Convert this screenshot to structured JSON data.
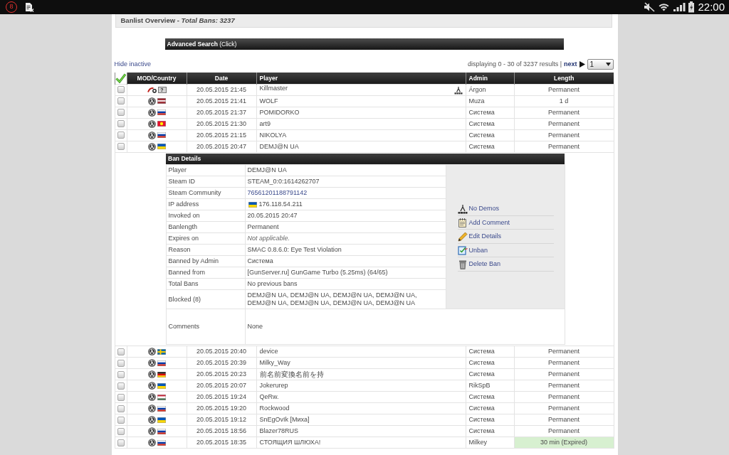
{
  "status_bar": {
    "notifications": "8",
    "time": "22:00"
  },
  "header": {
    "title": "Banlist Overview - *Total Bans: 3237*"
  },
  "advanced_search": {
    "label": "**Advanced Search** (Click)"
  },
  "toolbar": {
    "filter_link": "Hide inactive",
    "summary": "displaying 0 - 30 of 3237 results |",
    "next": "next",
    "page": "1"
  },
  "table": {
    "columns": [
      "MOD/Country",
      "Date",
      "Player",
      "Admin",
      "Length"
    ],
    "rows": [
      {
        "checked": false,
        "mod": {
          "kind": "other"
        },
        "flag": {
          "kind": "unknown",
          "label": "?"
        },
        "date": "20.05.2015 21:45",
        "player": "Killmaster",
        "demo": true,
        "admin": "Árgon",
        "length": "Permanent",
        "expired": false
      },
      {
        "checked": false,
        "mod": {
          "kind": "lambda"
        },
        "flag": {
          "kind": "lv"
        },
        "date": "20.05.2015 21:41",
        "player": "WOLF",
        "demo": false,
        "admin": "Muza",
        "length": "1 d",
        "expired": false
      },
      {
        "checked": false,
        "mod": {
          "kind": "lambda"
        },
        "flag": {
          "kind": "ru"
        },
        "date": "20.05.2015 21:37",
        "player": "POMIDORKO",
        "demo": false,
        "admin": "Система",
        "length": "Permanent",
        "expired": false
      },
      {
        "checked": false,
        "mod": {
          "kind": "lambda"
        },
        "flag": {
          "kind": "kg"
        },
        "date": "20.05.2015 21:30",
        "player": "art9",
        "demo": false,
        "admin": "Система",
        "length": "Permanent",
        "expired": false
      },
      {
        "checked": false,
        "mod": {
          "kind": "lambda"
        },
        "flag": {
          "kind": "ru"
        },
        "date": "20.05.2015 21:15",
        "player": "NIKOLYA",
        "demo": false,
        "admin": "Система",
        "length": "Permanent",
        "expired": false
      },
      {
        "checked": false,
        "mod": {
          "kind": "lambda"
        },
        "flag": {
          "kind": "ua"
        },
        "date": "20.05.2015 20:47",
        "player": "DEMJ@N UA",
        "demo": false,
        "admin": "Система",
        "length": "Permanent",
        "expired": false,
        "details": {
          "title": "Ban Details",
          "fields": [
            {
              "kind": "text",
              "label": "Player",
              "value": "DEMJ@N UA"
            },
            {
              "kind": "text",
              "label": "Steam ID",
              "value": "STEAM_0:0:1614262707"
            },
            {
              "kind": "link",
              "label": "Steam Community",
              "value": "76561201188791142"
            },
            {
              "kind": "ip",
              "label": "IP address",
              "value": "176.118.54.211",
              "flag": {
                "kind": "ua"
              }
            },
            {
              "kind": "text",
              "label": "Invoked on",
              "value": "20.05.2015 20:47"
            },
            {
              "kind": "text",
              "label": "Banlength",
              "value": "Permanent"
            },
            {
              "kind": "note",
              "label": "Expires on",
              "value": "Not applicable."
            },
            {
              "kind": "text",
              "label": "Reason",
              "value": "SMAC 0.8.6.0: Eye Test Violation"
            },
            {
              "kind": "text",
              "label": "Banned by Admin",
              "value": "Система"
            },
            {
              "kind": "text",
              "label": "Banned from",
              "value": "[GunServer.ru] GunGame Turbo (5.25ms) (64/65)"
            },
            {
              "kind": "text",
              "label": "Total Bans",
              "value": "No previous bans"
            },
            {
              "kind": "text",
              "label": "Blocked (8)",
              "value": "DEMJ@N UA, DEMJ@N UA, DEMJ@N UA, DEMJ@N UA, DEMJ@N UA, DEMJ@N UA, DEMJ@N UA, DEMJ@N UA"
            }
          ],
          "actions": [
            {
              "kind": "demo",
              "label": "No Demos"
            },
            {
              "kind": "comment",
              "label": "Add Comment"
            },
            {
              "kind": "edit",
              "label": "Edit Details"
            },
            {
              "kind": "unban",
              "label": "Unban"
            },
            {
              "kind": "delete",
              "label": "Delete Ban"
            }
          ],
          "comments": {
            "label": "Comments",
            "value": "None"
          }
        }
      },
      {
        "checked": false,
        "mod": {
          "kind": "lambda"
        },
        "flag": {
          "kind": "se"
        },
        "date": "20.05.2015 20:40",
        "player": "device",
        "demo": false,
        "admin": "Система",
        "length": "Permanent",
        "expired": false
      },
      {
        "checked": false,
        "mod": {
          "kind": "lambda"
        },
        "flag": {
          "kind": "ru"
        },
        "date": "20.05.2015 20:39",
        "player": "Milky_Way",
        "demo": false,
        "admin": "Система",
        "length": "Permanent",
        "expired": false
      },
      {
        "checked": false,
        "mod": {
          "kind": "lambda"
        },
        "flag": {
          "kind": "de"
        },
        "date": "20.05.2015 20:23",
        "player": "前名前変換名前を持",
        "demo": false,
        "admin": "Система",
        "length": "Permanent",
        "expired": false
      },
      {
        "checked": false,
        "mod": {
          "kind": "lambda"
        },
        "flag": {
          "kind": "ua"
        },
        "date": "20.05.2015 20:07",
        "player": "Jokerurep",
        "demo": false,
        "admin": "RikSpB",
        "length": "Permanent",
        "expired": false
      },
      {
        "checked": false,
        "mod": {
          "kind": "lambda"
        },
        "flag": {
          "kind": "hu"
        },
        "date": "20.05.2015 19:24",
        "player": "QeRw.",
        "demo": false,
        "admin": "Система",
        "length": "Permanent",
        "expired": false
      },
      {
        "checked": false,
        "mod": {
          "kind": "lambda"
        },
        "flag": {
          "kind": "ru"
        },
        "date": "20.05.2015 19:20",
        "player": "Rockwood",
        "demo": false,
        "admin": "Система",
        "length": "Permanent",
        "expired": false
      },
      {
        "checked": false,
        "mod": {
          "kind": "lambda"
        },
        "flag": {
          "kind": "ua"
        },
        "date": "20.05.2015 19:12",
        "player": "SnEgOvIk [Миха]",
        "demo": false,
        "admin": "Система",
        "length": "Permanent",
        "expired": false
      },
      {
        "checked": false,
        "mod": {
          "kind": "lambda"
        },
        "flag": {
          "kind": "ru"
        },
        "date": "20.05.2015 18:56",
        "player": "Blazer78RUS",
        "demo": false,
        "admin": "Система",
        "length": "Permanent",
        "expired": false
      },
      {
        "checked": false,
        "mod": {
          "kind": "lambda"
        },
        "flag": {
          "kind": "ru"
        },
        "date": "20.05.2015 18:35",
        "player": "СТОЯЩИЯ ШЛЮХА!",
        "demo": false,
        "admin": "Milkey",
        "length": "30 min (Expired)",
        "expired": true
      }
    ]
  }
}
